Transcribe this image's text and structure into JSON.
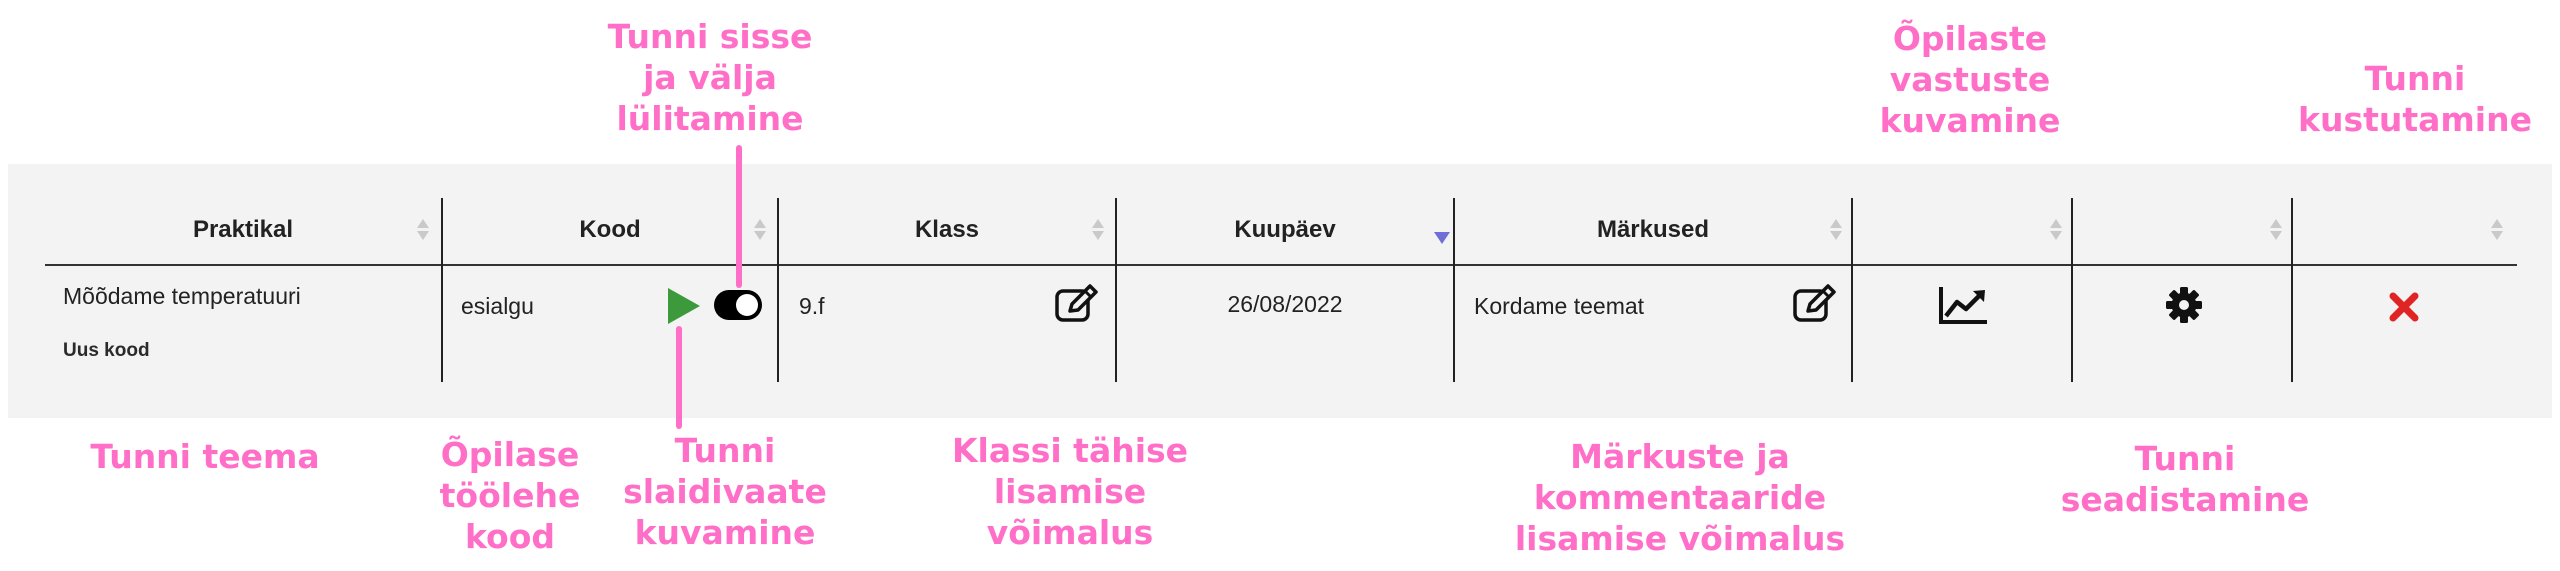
{
  "table": {
    "headers": [
      "Praktikal",
      "Kood",
      "Klass",
      "Kuupäev",
      "Märkused",
      "",
      "",
      ""
    ],
    "sorted_column": "Kuupäev",
    "row": {
      "praktikal_title": "Mõõdame temperatuuri",
      "praktikal_sub": "Uus kood",
      "kood": "esialgu",
      "lesson_toggle_on": true,
      "klass": "9.f",
      "kuupaev": "26/08/2022",
      "markused": "Kordame teemat"
    }
  },
  "callouts": {
    "toggle": [
      "Tunni sisse",
      "ja välja",
      "lülitamine"
    ],
    "answers": [
      "Õpilaste",
      "vastuste",
      "kuvamine"
    ],
    "delete": [
      "Tunni",
      "kustutamine"
    ],
    "topic": [
      "Tunni teema"
    ],
    "code": [
      "Õpilase",
      "töölehe",
      "kood"
    ],
    "slides": [
      "Tunni",
      "slaidivaate",
      "kuvamine"
    ],
    "class": [
      "Klassi tähise",
      "lisamise",
      "võimalus"
    ],
    "notes": [
      "Märkuste ja",
      "kommentaaride",
      "lisamise võimalus"
    ],
    "settings": [
      "Tunni",
      "seadistamine"
    ]
  },
  "colors": {
    "callout": "#ff6ec7",
    "play": "#3c9a3c",
    "delete": "#e02424",
    "sort_active": "#6f6fd6",
    "panel": "#f3f3f3"
  },
  "icons": [
    "play-icon",
    "toggle-switch",
    "edit-icon",
    "chart-icon",
    "gear-icon",
    "delete-icon"
  ]
}
